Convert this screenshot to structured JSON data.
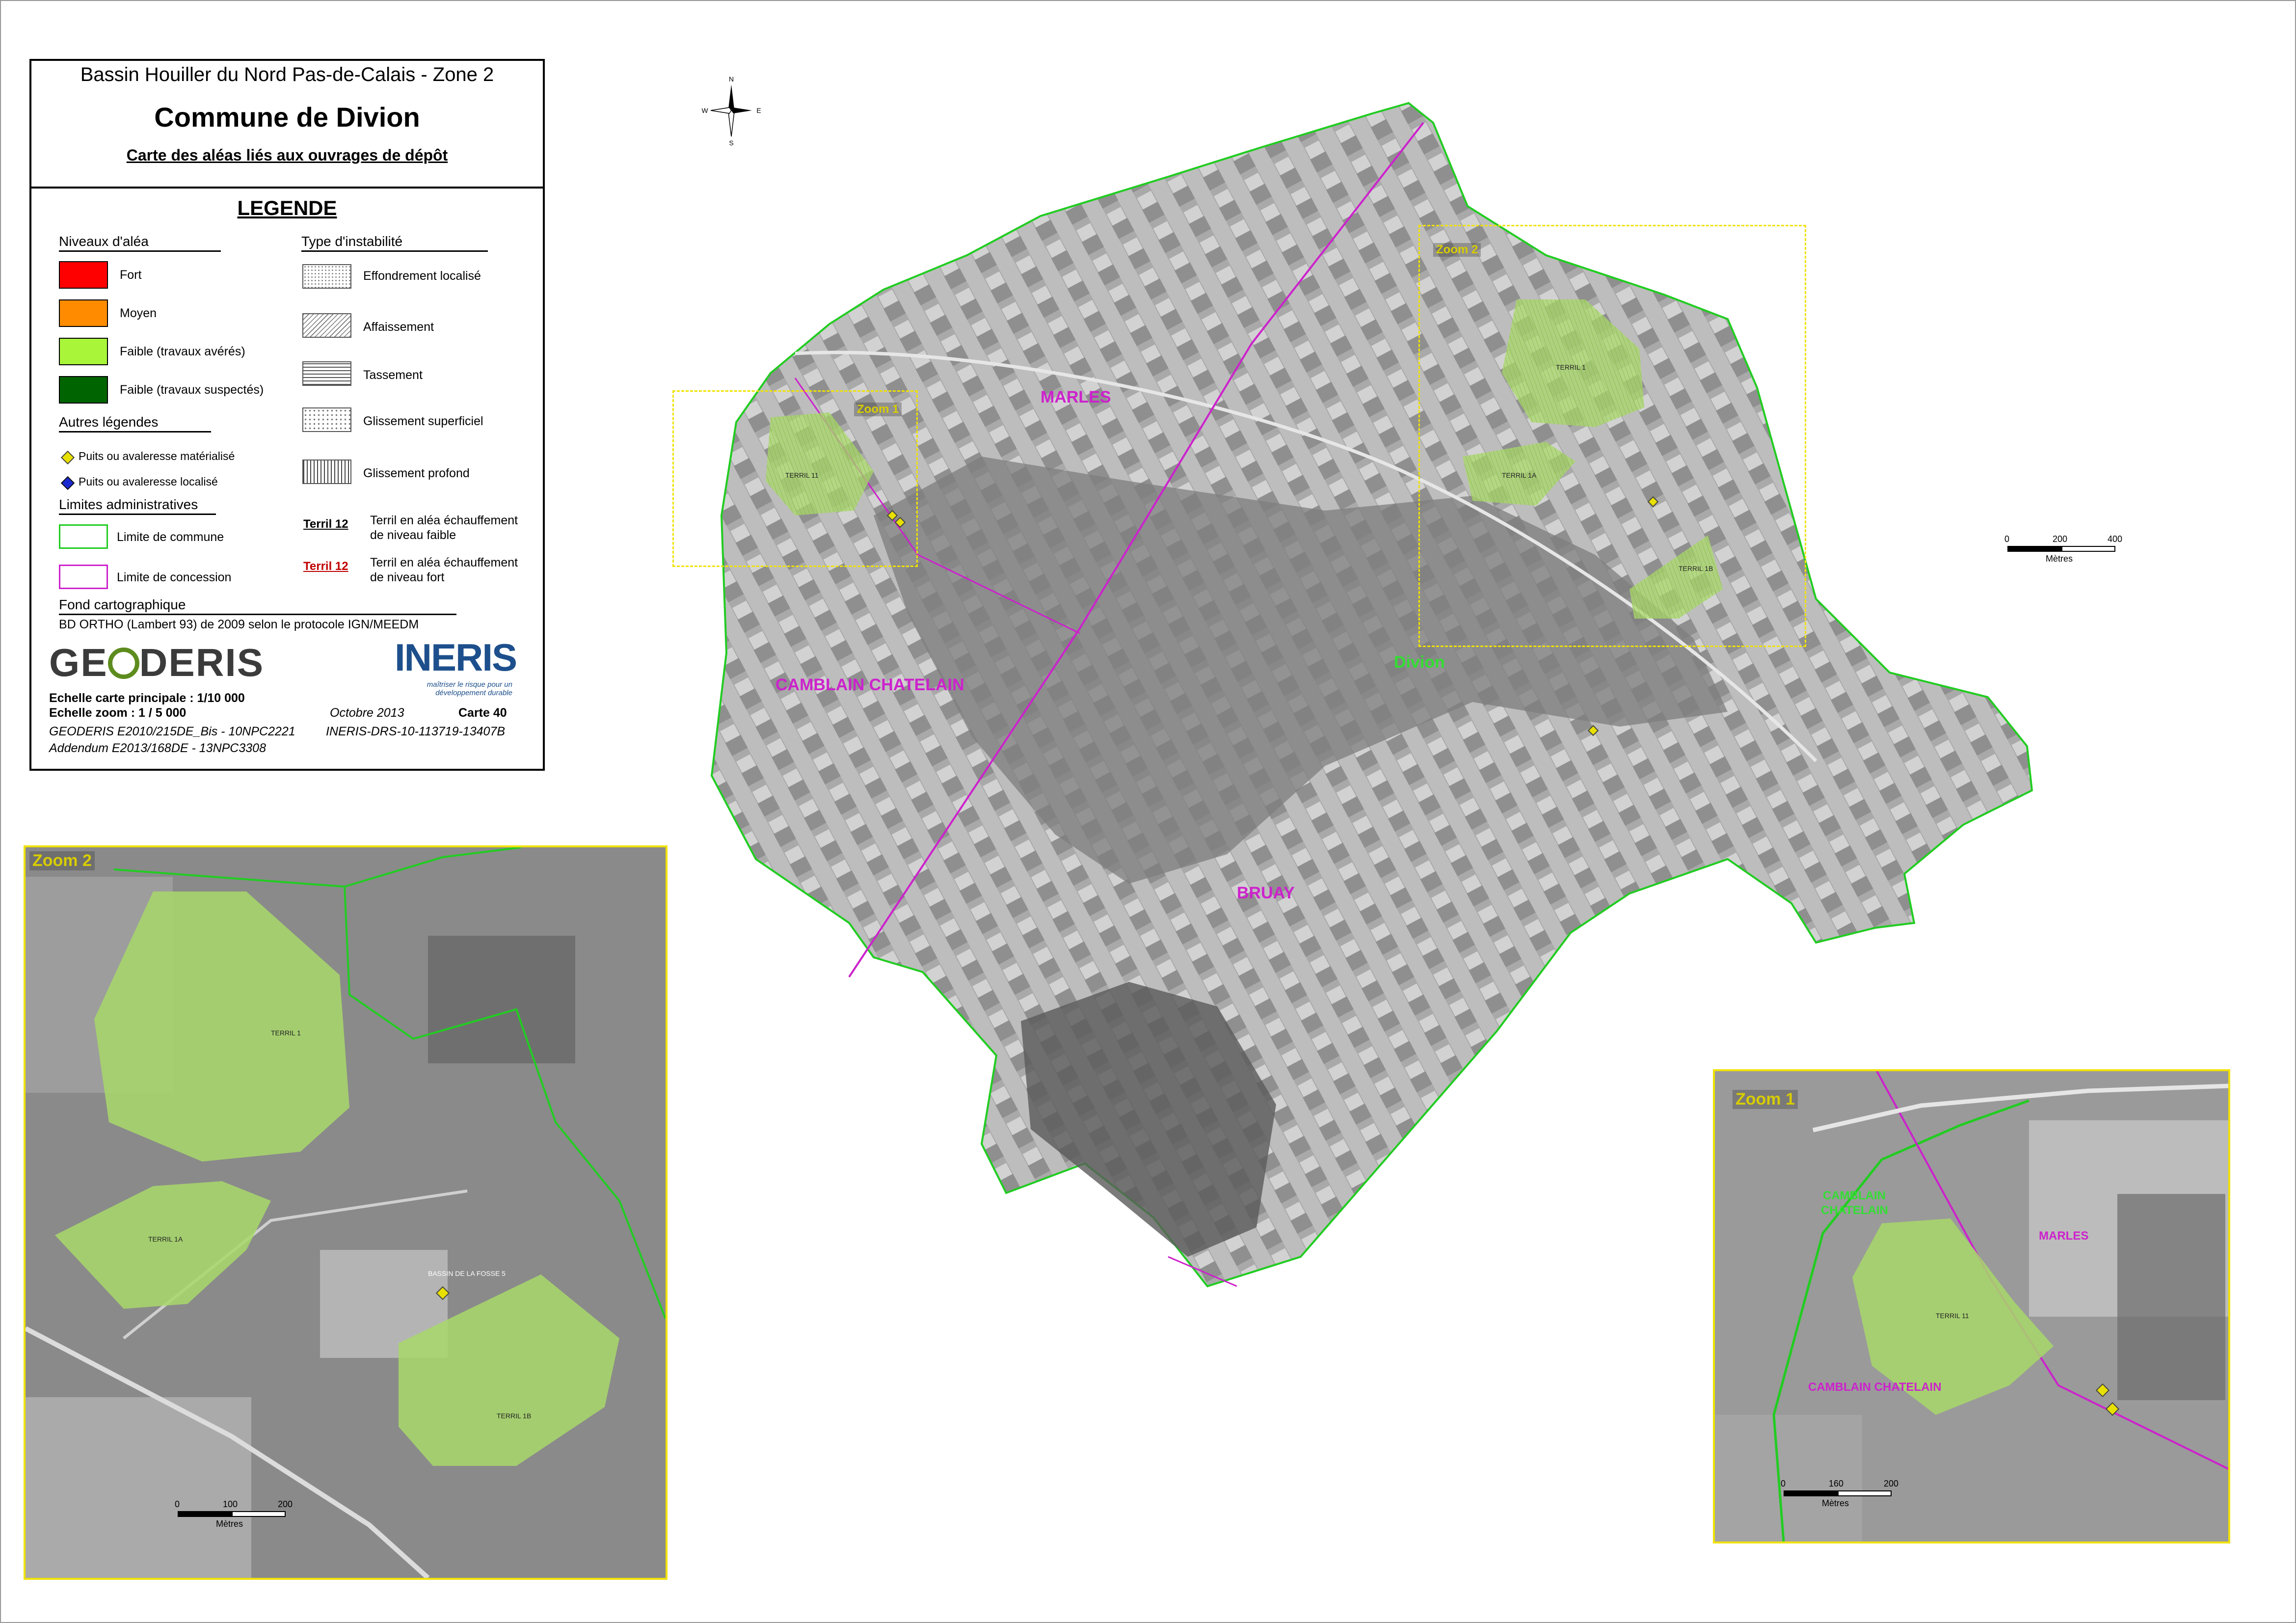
{
  "title": {
    "region": "Bassin Houiller du Nord Pas-de-Calais - Zone 2",
    "commune": "Commune de Divion",
    "subtitle": "Carte des aléas liés aux ouvrages de dépôt"
  },
  "legend": {
    "heading": "LEGENDE",
    "hazard_levels": {
      "heading": "Niveaux d'aléa",
      "items": [
        {
          "label": "Fort",
          "color": "#ff0000"
        },
        {
          "label": "Moyen",
          "color": "#ff8c00"
        },
        {
          "label": "Faible (travaux avérés)",
          "color": "#a8f53a"
        },
        {
          "label": "Faible (travaux suspectés)",
          "color": "#006400"
        }
      ]
    },
    "instability_types": {
      "heading": "Type d'instabilité",
      "items": [
        {
          "label": "Effondrement  localisé"
        },
        {
          "label": "Affaissement"
        },
        {
          "label": "Tassement"
        },
        {
          "label": "Glissement superficiel"
        },
        {
          "label": "Glissement profond"
        }
      ]
    },
    "other": {
      "heading": "Autres légendes",
      "items": [
        {
          "label": "Puits ou avaleresse matérialisé",
          "color": "#e8e000"
        },
        {
          "label": "Puits ou avaleresse localisé",
          "color": "#1b2ad0"
        }
      ]
    },
    "admin_limits": {
      "heading": "Limites administratives",
      "items": [
        {
          "label": "Limite de commune",
          "color": "#22cc22"
        },
        {
          "label": "Limite de concession",
          "color": "#cc22cc"
        }
      ]
    },
    "terril": {
      "low": {
        "tag": "Terril 12",
        "label_1": "Terril en aléa échauffement",
        "label_2": "de niveau faible"
      },
      "high": {
        "tag": "Terril 12",
        "label_1": "Terril en aléa échauffement",
        "label_2": "de niveau fort",
        "color": "#c00000"
      }
    },
    "basemap": {
      "heading": "Fond cartographique",
      "text": "BD ORTHO (Lambert 93) de 2009 selon le protocole IGN/MEEDM"
    }
  },
  "logos": {
    "geoderis_1": "GE",
    "geoderis_2": "DERIS",
    "ineris": "INERIS",
    "ineris_tag": "maîtriser le risque pour un développement durable"
  },
  "meta": {
    "scale_main": "Echelle carte principale : 1/10 000",
    "scale_zoom": "Echelle zoom : 1 / 5 000",
    "date": "Octobre 2013",
    "map_no": "Carte 40",
    "ref_geoderis": "GEODERIS E2010/215DE_Bis - 10NPC2221",
    "ref_ineris": "INERIS-DRS-10-113719-13407B",
    "addendum": "Addendum E2013/168DE - 13NPC3308"
  },
  "compass": {
    "n": "N",
    "s": "S",
    "e": "E",
    "w": "W"
  },
  "main_map": {
    "places": [
      {
        "name": "MARLES",
        "color": "#cc22cc"
      },
      {
        "name": "CAMBLAIN CHATELAIN",
        "color": "#cc22cc"
      },
      {
        "name": "Divion",
        "color": "#33dd33"
      },
      {
        "name": "BRUAY",
        "color": "#cc22cc"
      }
    ],
    "zoom_1": "Zoom 1",
    "zoom_2": "Zoom 2",
    "terrils": [
      "TERRIL 11",
      "TERRIL 1",
      "TERRIL 1A",
      "TERRIL 1B"
    ],
    "scale": {
      "ticks": [
        "0",
        "200",
        "400"
      ],
      "unit": "Mètres"
    }
  },
  "zoom_2_inset": {
    "title": "Zoom 2",
    "terrils": [
      "TERRIL 1",
      "TERRIL 1A",
      "TERRIL 1B"
    ],
    "site": "BASSIN DE LA FOSSE 5",
    "scale": {
      "ticks": [
        "0",
        "100",
        "200"
      ],
      "unit": "Mètres"
    }
  },
  "zoom_1_inset": {
    "title": "Zoom 1",
    "places": [
      {
        "name": "CAMBLAIN",
        "color": "#33dd33"
      },
      {
        "name": "CHATELAIN",
        "color": "#33dd33"
      },
      {
        "name": "MARLES",
        "color": "#cc22cc"
      },
      {
        "name": "CAMBLAIN CHATELAIN",
        "color": "#cc22cc"
      }
    ],
    "terril": "TERRIL 11",
    "scale": {
      "ticks": [
        "0",
        "160",
        "200"
      ],
      "unit": "Mètres"
    }
  }
}
